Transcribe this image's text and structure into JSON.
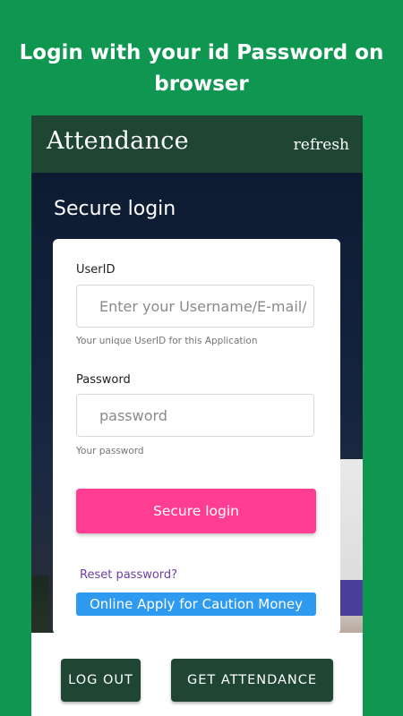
{
  "headline": {
    "line1": "Login with your id Password on",
    "line2": "browser"
  },
  "appbar": {
    "title": "Attendance",
    "refresh": "refresh"
  },
  "login": {
    "heading": "Secure login",
    "userid_label": "UserID",
    "userid_placeholder": "Enter your Username/E-mail/L",
    "userid_helper": "Your unique UserID for this Application",
    "password_label": "Password",
    "password_placeholder": "password",
    "password_helper": "Your password",
    "submit": "Secure login",
    "reset": "Reset password?",
    "caution": "Online Apply for Caution Money"
  },
  "bottom": {
    "logout": "LOG OUT",
    "get_attendance": "GET ATTENDANCE"
  },
  "colors": {
    "page_bg": "#0f9650",
    "appbar": "#1f4633",
    "login_button": "#ff3d93",
    "caution_button": "#2e9bf0",
    "link": "#6a3fa0"
  }
}
